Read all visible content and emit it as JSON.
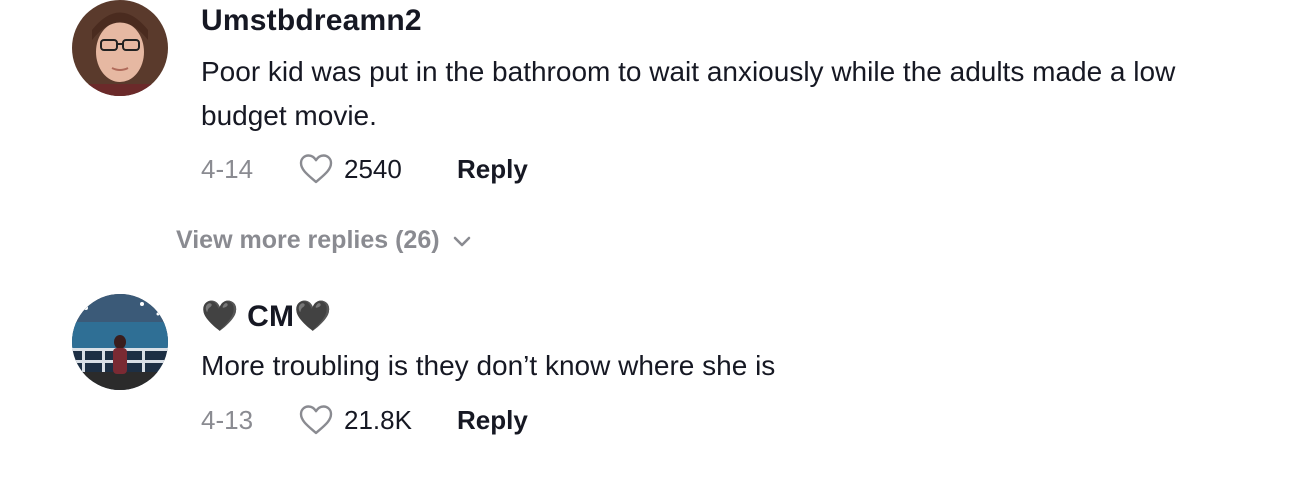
{
  "comments": [
    {
      "username": "Umstbdreamn2",
      "text": "Poor kid was put in the bathroom to wait anxiously while the adults made a low budget movie.",
      "date": "4-14",
      "likes": "2540",
      "reply_label": "Reply",
      "avatar": "woman-with-glasses-photo"
    },
    {
      "username": "🖤 CM🖤",
      "text": "More troubling is they don’t know where she is",
      "date": "4-13",
      "likes": "21.8K",
      "reply_label": "Reply",
      "avatar": "person-by-railing-at-night-photo"
    }
  ],
  "view_more_replies": "View more replies (26)",
  "icons": {
    "like": "heart-outline-icon",
    "expand": "chevron-down-icon"
  },
  "colors": {
    "primary_text": "#161823",
    "secondary_text": "#8a8b91"
  }
}
